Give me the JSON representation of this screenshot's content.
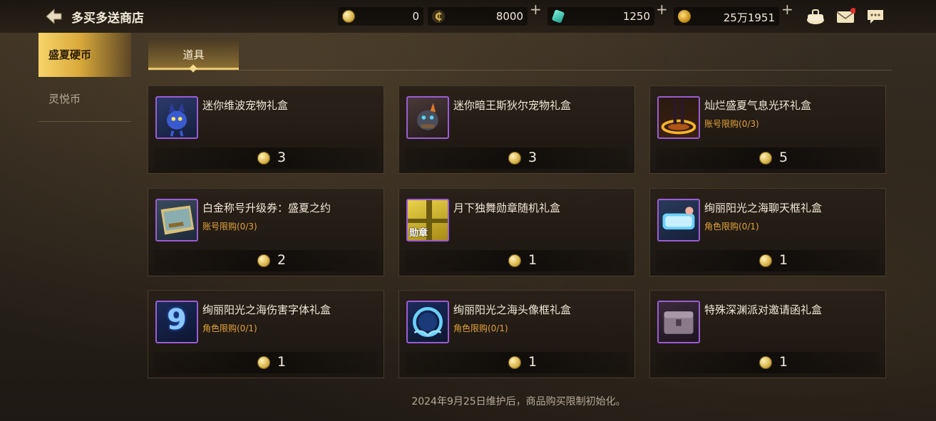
{
  "header": {
    "title": "多买多送商店",
    "currencies": [
      {
        "icon": "summer-coin-icon",
        "value": "0"
      },
      {
        "icon": "c-coin-icon",
        "value": "8000"
      },
      {
        "icon": "gem-icon",
        "value": "1250"
      },
      {
        "icon": "gold-coin-icon",
        "value": "25万1951"
      }
    ],
    "plus": "+",
    "right_icons": [
      "bag-icon",
      "mail-icon",
      "chat-icon"
    ]
  },
  "sidebar": {
    "items": [
      {
        "label": "盛夏硬币",
        "active": true
      },
      {
        "label": "灵悦币",
        "active": false
      }
    ]
  },
  "category_tab": {
    "label": "道具"
  },
  "items": [
    {
      "name": "迷你维波宠物礼盒",
      "limit": "",
      "price": "3",
      "icon": "mini-pet-blue-icon"
    },
    {
      "name": "迷你暗王斯狄尔宠物礼盒",
      "limit": "",
      "price": "3",
      "icon": "mini-pet-dark-icon"
    },
    {
      "name": "灿烂盛夏气息光环礼盒",
      "limit": "账号限购(0/3)",
      "price": "5",
      "icon": "aura-icon"
    },
    {
      "name": "白金称号升级券：盛夏之约",
      "limit": "账号限购(0/3)",
      "price": "2",
      "icon": "ticket-icon"
    },
    {
      "name": "月下独舞勋章随机礼盒",
      "limit": "",
      "price": "1",
      "icon": "medal-box-icon",
      "icon_text": "勋章"
    },
    {
      "name": "绚丽阳光之海聊天框礼盒",
      "limit": "角色限购(0/1)",
      "price": "1",
      "icon": "chat-frame-icon"
    },
    {
      "name": "绚丽阳光之海伤害字体礼盒",
      "limit": "角色限购(0/1)",
      "price": "1",
      "icon": "damage-font-icon",
      "icon_text": "9"
    },
    {
      "name": "绚丽阳光之海头像框礼盒",
      "limit": "角色限购(0/1)",
      "price": "1",
      "icon": "avatar-frame-icon"
    },
    {
      "name": "特殊深渊派对邀请函礼盒",
      "limit": "",
      "price": "1",
      "icon": "abyss-chest-icon"
    }
  ],
  "footer_note": "2024年9月25日维护后，商品购买限制初始化。",
  "colors": {
    "accent_gold": "#e9c768",
    "limit_orange": "#e4a23a",
    "rarity_purple": "#9b5cd6"
  }
}
